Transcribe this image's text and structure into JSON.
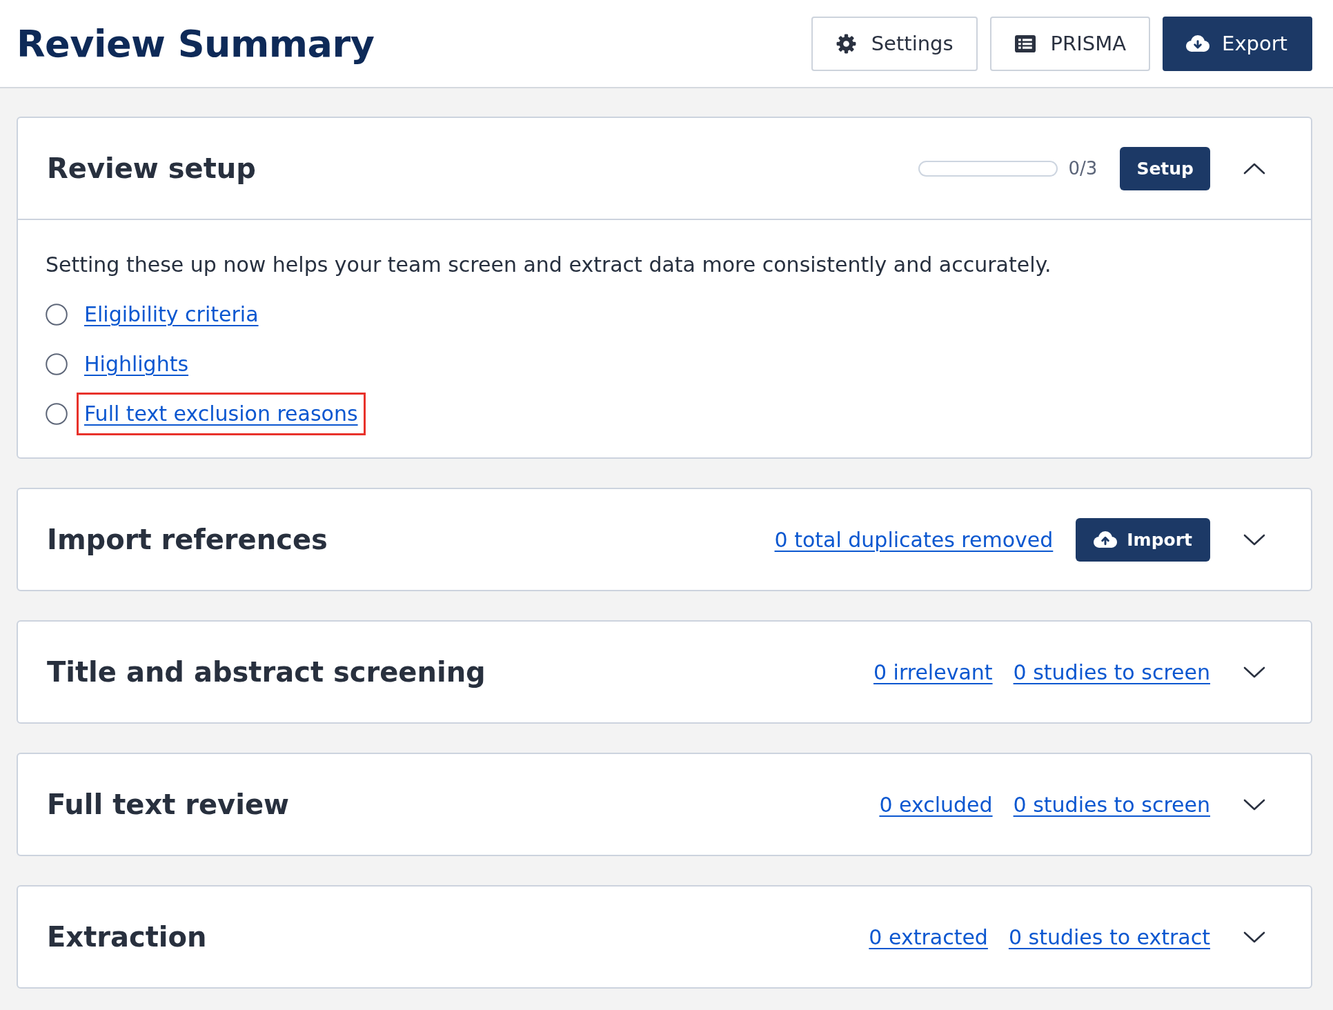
{
  "header": {
    "title": "Review Summary",
    "buttons": [
      {
        "label": "Settings",
        "kind": "secondary"
      },
      {
        "label": "PRISMA",
        "kind": "secondary"
      },
      {
        "label": "Export",
        "kind": "primary"
      }
    ]
  },
  "sections": [
    {
      "title": "Review setup",
      "expanded": true,
      "progress": {
        "level": 0,
        "reading": "0/3"
      },
      "button": {
        "label": "Setup",
        "kind": "plain"
      },
      "description": "Setting these up now helps your team screen and extract data more consistently and accurately.",
      "items": [
        {
          "label": "Eligibility criteria",
          "checked": false,
          "highlighted": false
        },
        {
          "label": "Highlights",
          "checked": false,
          "highlighted": false
        },
        {
          "label": "Full text exclusion reasons",
          "checked": false,
          "highlighted": true
        }
      ]
    },
    {
      "title": "Import references",
      "expanded": false,
      "links": [
        "0 total duplicates removed"
      ],
      "button": {
        "label": "Import",
        "kind": "upload"
      }
    },
    {
      "title": "Title and abstract screening",
      "expanded": false,
      "links": [
        "0 irrelevant",
        "0 studies to screen"
      ]
    },
    {
      "title": "Full text review",
      "expanded": false,
      "links": [
        "0 excluded",
        "0 studies to screen"
      ]
    },
    {
      "title": "Extraction",
      "expanded": false,
      "links": [
        "0 extracted",
        "0 studies to extract"
      ]
    }
  ]
}
